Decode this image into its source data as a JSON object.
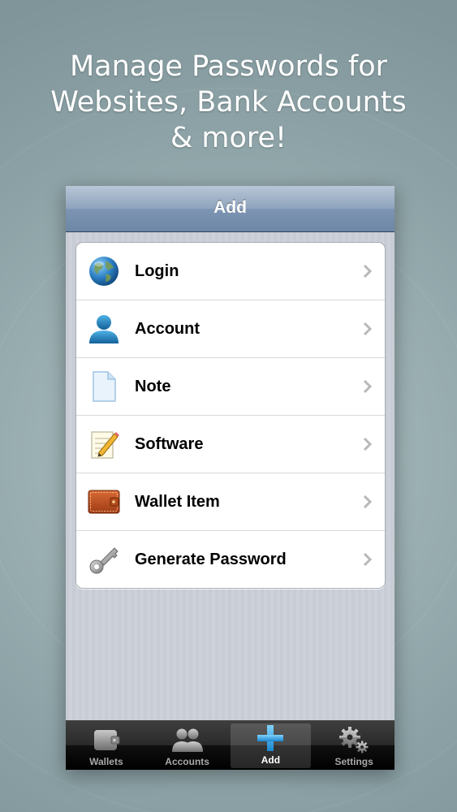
{
  "headline": {
    "line1": "Manage Passwords for",
    "line2": "Websites, Bank Accounts",
    "line3": "& more!"
  },
  "navbar": {
    "title": "Add"
  },
  "list": {
    "items": [
      {
        "label": "Login",
        "icon": "globe-icon"
      },
      {
        "label": "Account",
        "icon": "person-icon"
      },
      {
        "label": "Note",
        "icon": "document-icon"
      },
      {
        "label": "Software",
        "icon": "notepad-pencil-icon"
      },
      {
        "label": "Wallet Item",
        "icon": "wallet-icon"
      },
      {
        "label": "Generate Password",
        "icon": "key-icon"
      }
    ]
  },
  "tabbar": {
    "tabs": [
      {
        "label": "Wallets",
        "icon": "wallet-tab-icon",
        "active": false
      },
      {
        "label": "Accounts",
        "icon": "accounts-tab-icon",
        "active": false
      },
      {
        "label": "Add",
        "icon": "plus-tab-icon",
        "active": true
      },
      {
        "label": "Settings",
        "icon": "gears-tab-icon",
        "active": false
      }
    ]
  },
  "colors": {
    "background": "#8fa5a9",
    "navbar": "#7d95b2",
    "tabbar": "#1a1a1a",
    "active_tab_icon": "#2fa8e8"
  }
}
